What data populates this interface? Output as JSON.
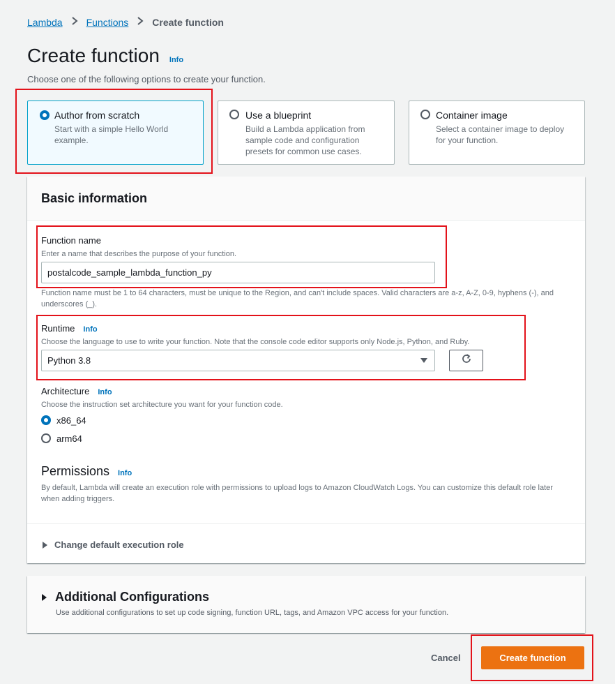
{
  "breadcrumb": {
    "item1": "Lambda",
    "item2": "Functions",
    "current": "Create function"
  },
  "page": {
    "title": "Create function",
    "info": "Info",
    "subtitle": "Choose one of the following options to create your function."
  },
  "options": [
    {
      "title": "Author from scratch",
      "desc": "Start with a simple Hello World example.",
      "selected": true
    },
    {
      "title": "Use a blueprint",
      "desc": "Build a Lambda application from sample code and configuration presets for common use cases.",
      "selected": false
    },
    {
      "title": "Container image",
      "desc": "Select a container image to deploy for your function.",
      "selected": false
    }
  ],
  "basic": {
    "heading": "Basic information",
    "function_name": {
      "label": "Function name",
      "desc": "Enter a name that describes the purpose of your function.",
      "value": "postalcode_sample_lambda_function_py",
      "constraint": "Function name must be 1 to 64 characters, must be unique to the Region, and can't include spaces. Valid characters are a-z, A-Z, 0-9, hyphens (-), and underscores (_)."
    },
    "runtime": {
      "label": "Runtime",
      "info": "Info",
      "desc": "Choose the language to use to write your function. Note that the console code editor supports only Node.js, Python, and Ruby.",
      "value": "Python 3.8"
    },
    "architecture": {
      "label": "Architecture",
      "info": "Info",
      "desc": "Choose the instruction set architecture you want for your function code.",
      "opt1": "x86_64",
      "opt2": "arm64"
    },
    "permissions": {
      "label": "Permissions",
      "info": "Info",
      "desc": "By default, Lambda will create an execution role with permissions to upload logs to Amazon CloudWatch Logs. You can customize this default role later when adding triggers."
    },
    "exec_role": "Change default execution role"
  },
  "additional": {
    "title": "Additional Configurations",
    "desc": "Use additional configurations to set up code signing, function URL, tags, and Amazon VPC access for your function."
  },
  "footer": {
    "cancel": "Cancel",
    "create": "Create function"
  },
  "colors": {
    "accent": "#0073bb",
    "primary_button": "#ec7211",
    "highlight": "#e3121a"
  }
}
